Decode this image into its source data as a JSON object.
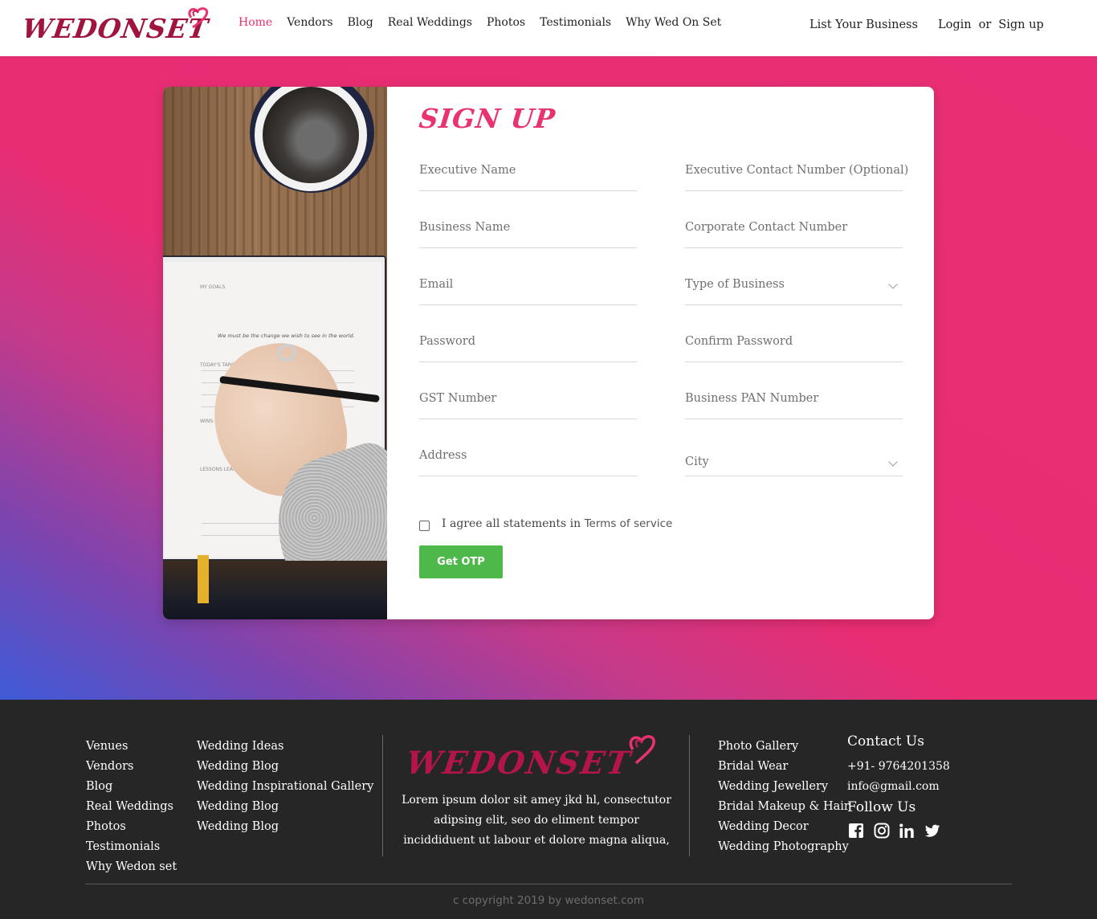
{
  "header": {
    "logo_text": "WEDONSET",
    "nav": [
      {
        "label": "Home",
        "active": true
      },
      {
        "label": "Vendors"
      },
      {
        "label": "Blog"
      },
      {
        "label": "Real Weddings"
      },
      {
        "label": "Photos"
      },
      {
        "label": "Testimonials"
      },
      {
        "label": "Why Wed On Set"
      }
    ],
    "list_business": "List Your Business",
    "login": "Login",
    "or": "or",
    "signup": "Sign up"
  },
  "colors": {
    "brand_pink": "#e8336e",
    "gradient_blue": "#3f5bd8",
    "otp_green": "#4fb84a",
    "footer_bg": "#262626"
  },
  "form": {
    "title": "SIGN UP",
    "fields_left": [
      {
        "label": "Executive Name",
        "type": "text"
      },
      {
        "label": "Business Name",
        "type": "text"
      },
      {
        "label": "Email",
        "type": "text"
      },
      {
        "label": "Password",
        "type": "text"
      },
      {
        "label": "GST Number",
        "type": "text"
      },
      {
        "label": "Address",
        "type": "text"
      }
    ],
    "fields_right": [
      {
        "label": "Executive Contact Number (Optional)",
        "type": "text"
      },
      {
        "label": "Corporate Contact Number",
        "type": "text"
      },
      {
        "label": "Type of Business",
        "type": "select"
      },
      {
        "label": "Confirm Password",
        "type": "text"
      },
      {
        "label": "Business PAN Number",
        "type": "text"
      },
      {
        "label": "City",
        "type": "select"
      }
    ],
    "agree_text": "I agree all statements in",
    "terms_link": "Terms of service",
    "otp_button": "Get OTP"
  },
  "photo": {
    "notebook_heading": "MY GOALS",
    "notebook_quote": "We must be the change we wish to see in the world.",
    "notebook_today": "TODAY'S TARGETS",
    "notebook_wins": "WINS:",
    "notebook_lessons": "LESSONS LEARNED:"
  },
  "footer": {
    "col1": [
      "Venues",
      "Vendors",
      "Blog",
      "Real Weddings",
      "Photos",
      "Testimonials",
      "Why Wedon set"
    ],
    "col2": [
      "Wedding Ideas",
      "Wedding Blog",
      "Wedding Inspirational Gallery",
      "Wedding Blog",
      "Wedding Blog"
    ],
    "logo_text": "WEDONSET",
    "about": "Lorem ipsum dolor sit amey jkd hl, consectutor adipsing elit, seo do eliment tempor inciddiduent ut labour et dolore magna aliqua,",
    "col3": [
      "Photo Gallery",
      "Bridal Wear",
      "Wedding Jewellery",
      "Bridal Makeup & Hair",
      "Wedding Decor",
      "Wedding Photography"
    ],
    "contact_title": "Contact Us",
    "phone": "+91- 9764201358",
    "email": "info@gmail.com",
    "follow_title": "Follow Us",
    "social_icons": [
      "facebook-icon",
      "instagram-icon",
      "linkedin-icon",
      "twitter-icon"
    ],
    "copyright": "c copyright 2019 by wedonset.com"
  }
}
